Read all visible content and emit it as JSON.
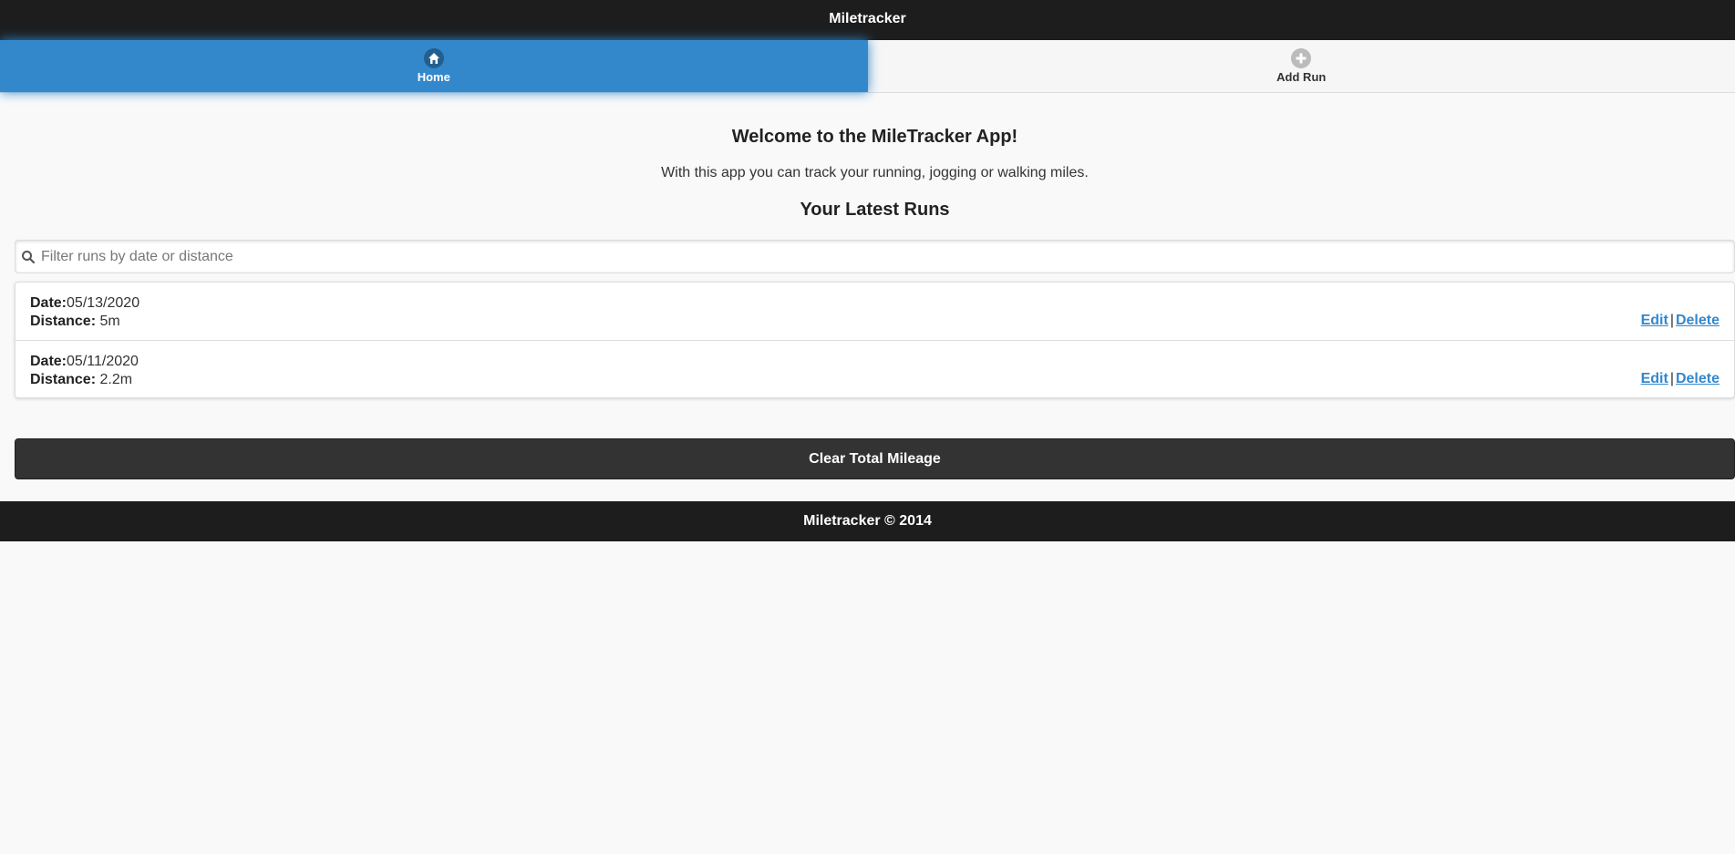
{
  "app": {
    "title": "Miletracker",
    "footer": "Miletracker © 2014"
  },
  "nav": {
    "home": {
      "label": "Home",
      "icon": "home-icon",
      "active": true
    },
    "add_run": {
      "label": "Add Run",
      "icon": "plus-icon",
      "active": false
    }
  },
  "main": {
    "welcome": "Welcome to the MileTracker App!",
    "intro": "With this app you can track your running, jogging or walking miles.",
    "runs_title": "Your Latest Runs",
    "filter": {
      "placeholder": "Filter runs by date or distance",
      "value": ""
    },
    "runs": [
      {
        "date_label": "Date:",
        "date": "05/13/2020",
        "distance_label": "Distance:",
        "distance": "5m",
        "edit": "Edit",
        "sep": "|",
        "delete": "Delete"
      },
      {
        "date_label": "Date:",
        "date": "05/11/2020",
        "distance_label": "Distance:",
        "distance": "2.2m",
        "edit": "Edit",
        "sep": "|",
        "delete": "Delete"
      }
    ],
    "clear_button": "Clear Total Mileage"
  },
  "colors": {
    "accent": "#3388cc",
    "header_bg": "#1d1d1d",
    "button_dark": "#333333",
    "page_bg": "#f9f9f9"
  }
}
